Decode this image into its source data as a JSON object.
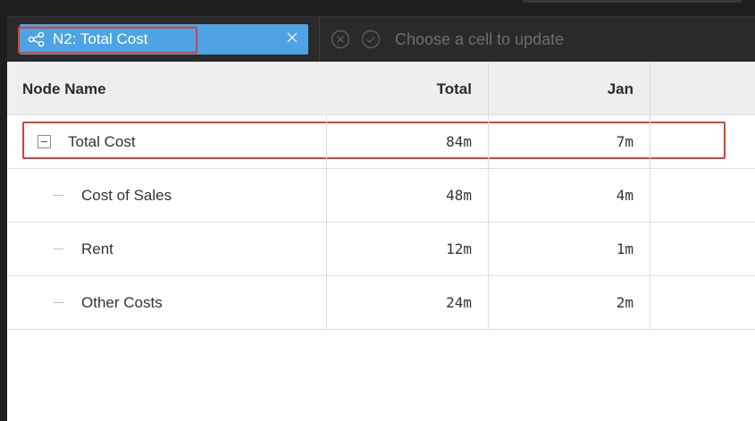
{
  "formula_bar": {
    "node_chip_label": "N2: Total Cost",
    "placeholder": "Choose a cell to update"
  },
  "table": {
    "columns": [
      "Node Name",
      "Total",
      "Jan"
    ],
    "rows": [
      {
        "name": "Total Cost",
        "total": "84m",
        "jan": "7m",
        "expandable": true
      },
      {
        "name": "Cost of Sales",
        "total": "48m",
        "jan": "4m",
        "expandable": false
      },
      {
        "name": "Rent",
        "total": "12m",
        "jan": "1m",
        "expandable": false
      },
      {
        "name": "Other Costs",
        "total": "24m",
        "jan": "2m",
        "expandable": false
      }
    ]
  },
  "colors": {
    "chip": "#4da3e3",
    "highlight": "#d9403a",
    "chrome": "#2a2a2a"
  },
  "icons": {
    "chip": "node-graph-icon",
    "chip_close": "close-icon",
    "cancel": "cancel-circle-icon",
    "confirm": "check-circle-icon",
    "collapse": "collapse-minus-icon"
  }
}
